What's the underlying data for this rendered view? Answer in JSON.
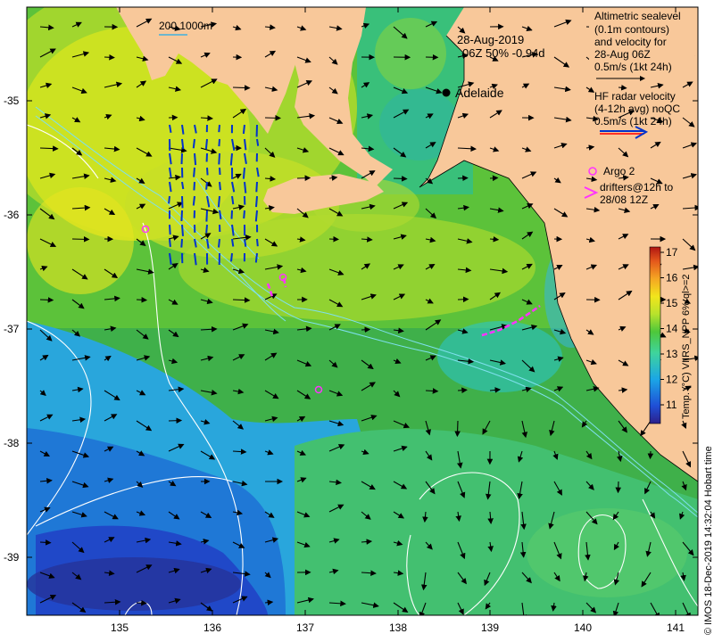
{
  "map": {
    "date_line": "28-Aug-2019",
    "time_line": "06Z  50% -0.94d",
    "scale_bar_label": "200  1000m",
    "city": "Adelaide",
    "lon_ticks": [
      "135",
      "136",
      "137",
      "138",
      "139",
      "140",
      "141"
    ],
    "lat_ticks": [
      "-35",
      "-36",
      "-37",
      "-38",
      "-39"
    ]
  },
  "legend": {
    "altimetry": [
      "Altimetric sealevel",
      "(0.1m contours)",
      "and velocity for",
      "28-Aug 06Z",
      "0.5m/s (1kt 24h)"
    ],
    "hf_radar": [
      "HF radar velocity",
      "(4-12h avg) noQC",
      "0.5m/s (1kt 24h)"
    ],
    "argo": "Argo 2",
    "drifters": [
      "drifters@12h to",
      "28/08 12Z"
    ]
  },
  "colorbar": {
    "ticks": [
      "17",
      "16",
      "15",
      "14",
      "13",
      "12",
      "11"
    ],
    "label": "Temp. (°C) VIIRS_NPP 6% ql>=2",
    "colors": [
      "#2c1f8a",
      "#1f4fd6",
      "#1ba6e6",
      "#3fd49c",
      "#4ec73a",
      "#b8e22c",
      "#f2e51c",
      "#f5a623",
      "#e4571b",
      "#b01612"
    ]
  },
  "credit": "© IMOS 18-Dec-2019 14:32:04 Hobart time",
  "colors": {
    "land": "#f8c89a",
    "hf_arrow": "#0033cc",
    "drifter": "#ff33ff",
    "contour": "#ffffff",
    "isobath": "#7ee0ee"
  }
}
